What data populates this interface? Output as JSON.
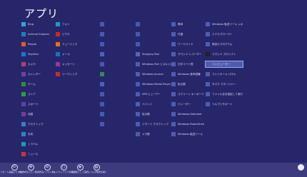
{
  "page": {
    "title": "アプリ"
  },
  "columns": [
    {
      "header": "",
      "apps": [
        {
          "label": "Bing",
          "color": "#2fa7d7"
        },
        {
          "label": "Internet Explorer",
          "color": "#1f7fc4"
        },
        {
          "label": "People",
          "color": "#e3592e"
        },
        {
          "label": "Skydrive",
          "color": "#1b76c9"
        },
        {
          "label": "カメラ",
          "color": "#b03e7d"
        },
        {
          "label": "カレンダー",
          "color": "#7c3aa3"
        },
        {
          "label": "ゲーム",
          "color": "#2f8d3f"
        },
        {
          "label": "ストア",
          "color": "#2f9a4c"
        },
        {
          "label": "スポーツ",
          "color": "#5a43a8"
        },
        {
          "label": "地図",
          "color": "#7a3aa0"
        },
        {
          "label": "デスクトップ",
          "color": "#3a7fc7"
        },
        {
          "label": "天気",
          "color": "#2c84d0"
        },
        {
          "label": "トラベル",
          "color": "#1e9bb8"
        },
        {
          "label": "ニュース",
          "color": "#c23a3a"
        }
      ]
    },
    {
      "header": "",
      "apps": [
        {
          "label": "フォト",
          "color": "#1c9bc9"
        },
        {
          "label": "ビデオ",
          "color": "#c52b2b"
        },
        {
          "label": "ミュージック",
          "color": "#e76d1f"
        },
        {
          "label": "メール",
          "color": "#1673c0"
        },
        {
          "label": "メッセージ",
          "color": "#9a35a8"
        },
        {
          "label": "リーディング",
          "color": "#c42f2f"
        }
      ]
    },
    {
      "header": "",
      "apps": [
        {
          "label": "",
          "color": "#4b5ab0"
        },
        {
          "label": "",
          "color": "#4b5ab0"
        },
        {
          "label": "",
          "color": "#3f59ba"
        },
        {
          "label": "",
          "color": "#4a63b8"
        },
        {
          "label": "",
          "color": "#4a57b4"
        },
        {
          "label": "",
          "color": "#2f8d4e"
        },
        {
          "label": "",
          "color": "#3f66c2"
        },
        {
          "label": "",
          "color": "#4858b0"
        },
        {
          "label": "",
          "color": "#4858b0"
        },
        {
          "label": "",
          "color": "#3f5eb8"
        },
        {
          "label": "",
          "color": "#4858b0"
        }
      ]
    },
    {
      "header": "",
      "apps": [
        {
          "label": "",
          "color": "#4858b0"
        },
        {
          "label": "",
          "color": "#4858b0"
        },
        {
          "label": "",
          "color": "#4858b0"
        },
        {
          "label": "Snipping Tool",
          "color": "#5566bb"
        },
        {
          "label": "Windows FAX とスキャン",
          "color": "#4c5db3"
        },
        {
          "label": "Windows Journal",
          "color": "#4c5db3"
        },
        {
          "label": "Windows Media Player",
          "color": "#3a5fbf"
        },
        {
          "label": "XPS ビューアー",
          "color": "#4c5db3"
        },
        {
          "label": "ペイント",
          "color": "#4c5db3"
        },
        {
          "label": "拡大鏡",
          "color": "#4c5db3"
        },
        {
          "label": "リモート デスクトップ",
          "color": "#4c5db3"
        },
        {
          "label": "メモ帳",
          "color": "#4c5db3"
        }
      ]
    },
    {
      "header": "",
      "apps": [
        {
          "label": "電卓",
          "color": "#4c5db3"
        },
        {
          "label": "付箋",
          "color": "#4c5db3"
        },
        {
          "label": "ワードパッド",
          "color": "#4c5db3"
        },
        {
          "label": "サウンド レコーダー",
          "color": "#4c5db3"
        },
        {
          "label": "文字コード表",
          "color": "#4c5db3"
        },
        {
          "label": "Windows 音声認識",
          "color": "#4c5db3"
        },
        {
          "label": "拡大鏡",
          "color": "#4c5db3"
        },
        {
          "label": "スクリーン キーボード",
          "color": "#4c5db3"
        },
        {
          "label": "ナレーター",
          "color": "#4c5db3"
        },
        {
          "label": "Windows Defender",
          "color": "#4c5db3"
        },
        {
          "label": "Windows PowerShell",
          "color": "#4c5db3"
        },
        {
          "label": "Windows 転送ツール",
          "color": "#4c5db3"
        }
      ]
    },
    {
      "header": "",
      "apps": [
        {
          "label": "Windows 転送ツール レポート",
          "color": "#4c5db3"
        },
        {
          "label": "エクスプローラー",
          "color": "#4c5db3"
        },
        {
          "label": "既定のプログラム",
          "color": "#4c5db3"
        },
        {
          "label": "コマンド プロンプト",
          "color": "#222222"
        },
        {
          "label": "コンピューター",
          "color": "#4c5db3"
        },
        {
          "label": "コントロール パネル",
          "color": "#4c5db3"
        },
        {
          "label": "タスク マネージャー",
          "color": "#4c5db3"
        },
        {
          "label": "ファイル名を指定して実行",
          "color": "#4c5db3"
        },
        {
          "label": "ヘルプとサポート",
          "color": "#4c5db3"
        }
      ]
    }
  ],
  "bottom_bar": {
    "buttons": [
      {
        "label": "スタート画面にピン留めする",
        "icon": "pin-icon"
      },
      {
        "label": "タスクバーにピン留めする",
        "icon": "taskbar-pin-icon"
      },
      {
        "label": "アンインストール",
        "icon": "uninstall-icon"
      },
      {
        "label": "新しいウィンドウを開く",
        "icon": "new-window-icon"
      },
      {
        "label": "管理者として実行",
        "icon": "admin-icon"
      },
      {
        "label": "ファイルの場所を開く",
        "icon": "folder-icon"
      }
    ]
  }
}
